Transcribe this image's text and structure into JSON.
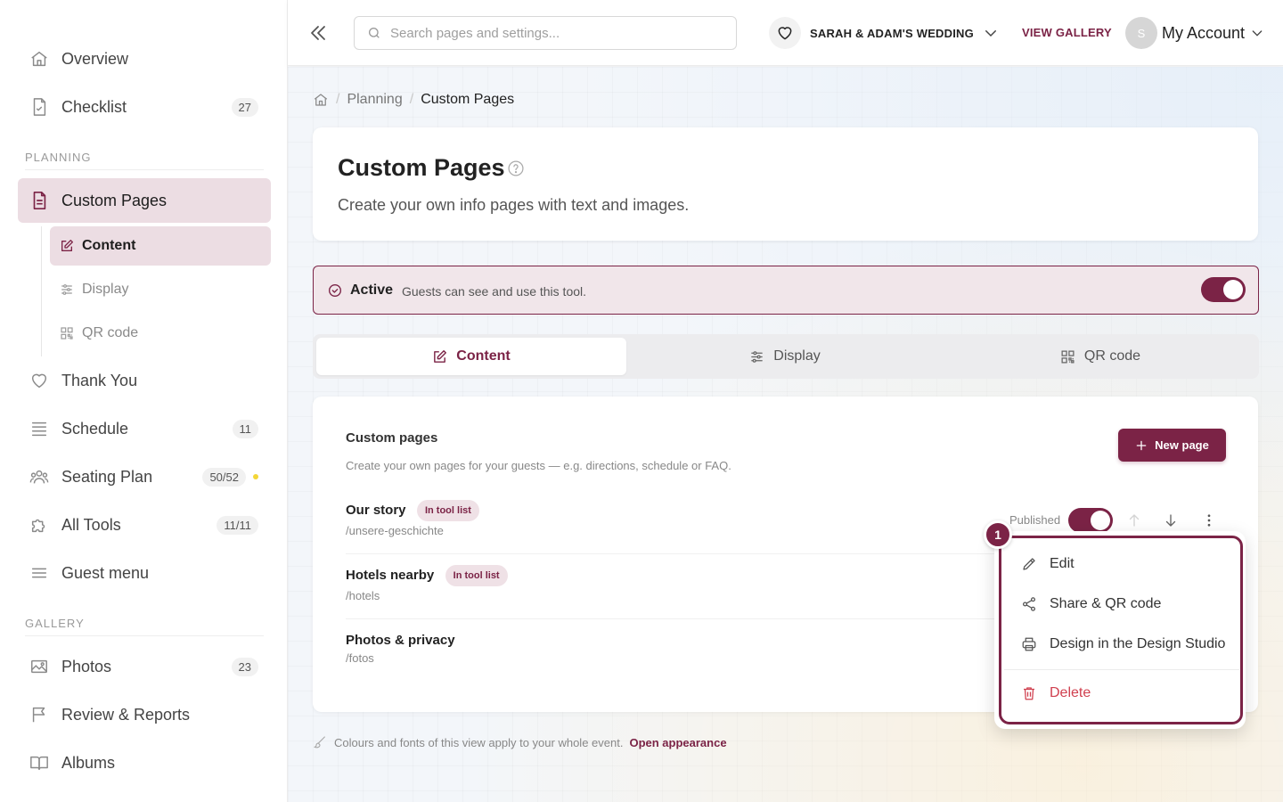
{
  "sidebar": {
    "items": [
      {
        "label": "Overview",
        "icon": "home-icon"
      },
      {
        "label": "Checklist",
        "icon": "file-check-icon",
        "badge": "27"
      }
    ],
    "planning_label": "PLANNING",
    "planning": {
      "custom_pages": {
        "label": "Custom Pages",
        "icon": "file-text-icon"
      },
      "sub_items": [
        {
          "label": "Content",
          "icon": "edit-icon"
        },
        {
          "label": "Display",
          "icon": "sliders-icon"
        },
        {
          "label": "QR code",
          "icon": "qr-code-icon"
        }
      ],
      "items": [
        {
          "label": "Thank You",
          "icon": "heart-icon"
        },
        {
          "label": "Schedule",
          "icon": "list-icon",
          "badge": "11"
        },
        {
          "label": "Seating Plan",
          "icon": "users-icon",
          "badge": "50/52"
        },
        {
          "label": "All Tools",
          "icon": "puzzle-icon",
          "badge": "11/11"
        },
        {
          "label": "Guest menu",
          "icon": "menu-icon"
        }
      ]
    },
    "gallery_label": "GALLERY",
    "gallery": [
      {
        "label": "Photos",
        "icon": "image-icon",
        "badge": "23"
      },
      {
        "label": "Review & Reports",
        "icon": "flag-icon"
      },
      {
        "label": "Albums",
        "icon": "book-open-icon"
      }
    ]
  },
  "header": {
    "search_placeholder": "Search pages and settings...",
    "event_name": "SARAH & ADAM'S WEDDING",
    "view_gallery": "VIEW GALLERY",
    "avatar_initial": "S",
    "account_label": "My Account"
  },
  "breadcrumb": {
    "parent": "Planning",
    "current": "Custom Pages"
  },
  "page": {
    "title": "Custom Pages",
    "subtitle": "Create your own info pages with text and images."
  },
  "status": {
    "label": "Active",
    "description": "Guests can see and use this tool."
  },
  "tabs": [
    {
      "label": "Content",
      "icon": "edit-icon"
    },
    {
      "label": "Display",
      "icon": "sliders-icon"
    },
    {
      "label": "QR code",
      "icon": "qr-code-icon"
    }
  ],
  "custom_pages": {
    "title": "Custom pages",
    "subtitle": "Create your own pages for your guests — e.g. directions, schedule or FAQ.",
    "new_button": "New page",
    "published_label": "Published",
    "rows": [
      {
        "name": "Our story",
        "pill": "In tool list",
        "path": "/unsere-geschichte"
      },
      {
        "name": "Hotels nearby",
        "pill": "In tool list",
        "path": "/hotels"
      },
      {
        "name": "Photos & privacy",
        "path": "/fotos"
      }
    ]
  },
  "context_menu": {
    "step": "1",
    "items": [
      {
        "label": "Edit",
        "icon": "pencil-icon"
      },
      {
        "label": "Share & QR code",
        "icon": "share-icon"
      },
      {
        "label": "Design in the Design Studio",
        "icon": "printer-icon"
      }
    ],
    "delete_label": "Delete"
  },
  "footnote": {
    "text": "Colours and fonts of this view apply to your whole event.",
    "link": "Open appearance"
  },
  "colors": {
    "accent": "#7b2346",
    "accent_soft": "#ecdde3",
    "danger": "#d0404f",
    "warning_dot": "#f3d637"
  }
}
